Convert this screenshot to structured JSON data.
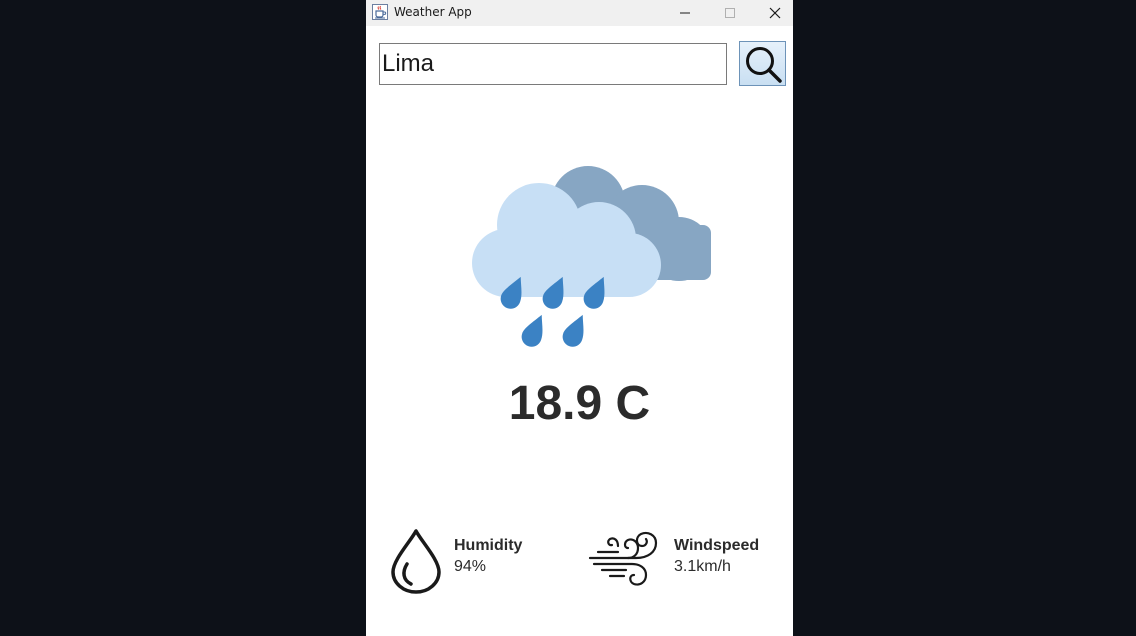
{
  "window": {
    "title": "Weather App",
    "app_icon": "java-coffee-cup-icon",
    "controls": [
      "minimize-icon",
      "maximize-icon",
      "close-icon"
    ]
  },
  "search": {
    "value": "Lima",
    "button_icon": "magnifier-icon"
  },
  "weather": {
    "condition_icon": "rain-cloud-icon",
    "temperature": "18.9 C"
  },
  "humidity": {
    "icon": "water-drop-icon",
    "label": "Humidity",
    "value": "94%"
  },
  "windspeed": {
    "icon": "wind-icon",
    "label": "Windspeed",
    "value": "3.1km/h"
  },
  "colors": {
    "screen_background": "#0d1118",
    "window_background": "#ffffff",
    "titlebar": "#f0f0f0",
    "cloud_back": "#87a6c3",
    "cloud_front": "#c7dff5",
    "raindrop": "#3b82c4",
    "text": "#2b2b2b"
  }
}
